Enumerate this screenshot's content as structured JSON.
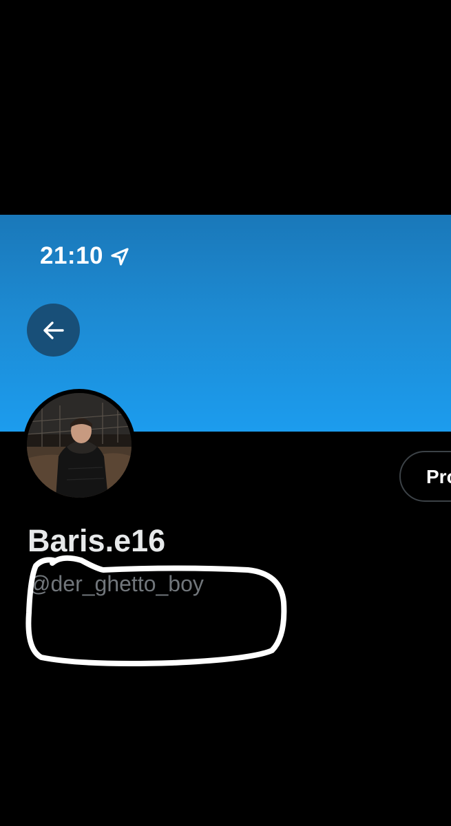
{
  "status_bar": {
    "time": "21:10",
    "location_icon": "location-arrow-icon"
  },
  "colors": {
    "banner_top": "#1a78b9",
    "banner_bottom": "#1c9cee",
    "back_button_bg": "#184f78",
    "background": "#000000",
    "display_name": "#e7e9ea",
    "handle": "#71767b",
    "annotation_stroke": "#ffffff"
  },
  "header": {
    "back_icon": "arrow-left-icon"
  },
  "profile": {
    "display_name": "Baris.e16",
    "handle": "@der_ghetto_boy",
    "avatar_icon": "profile-photo",
    "action_button_label": "Pro"
  }
}
